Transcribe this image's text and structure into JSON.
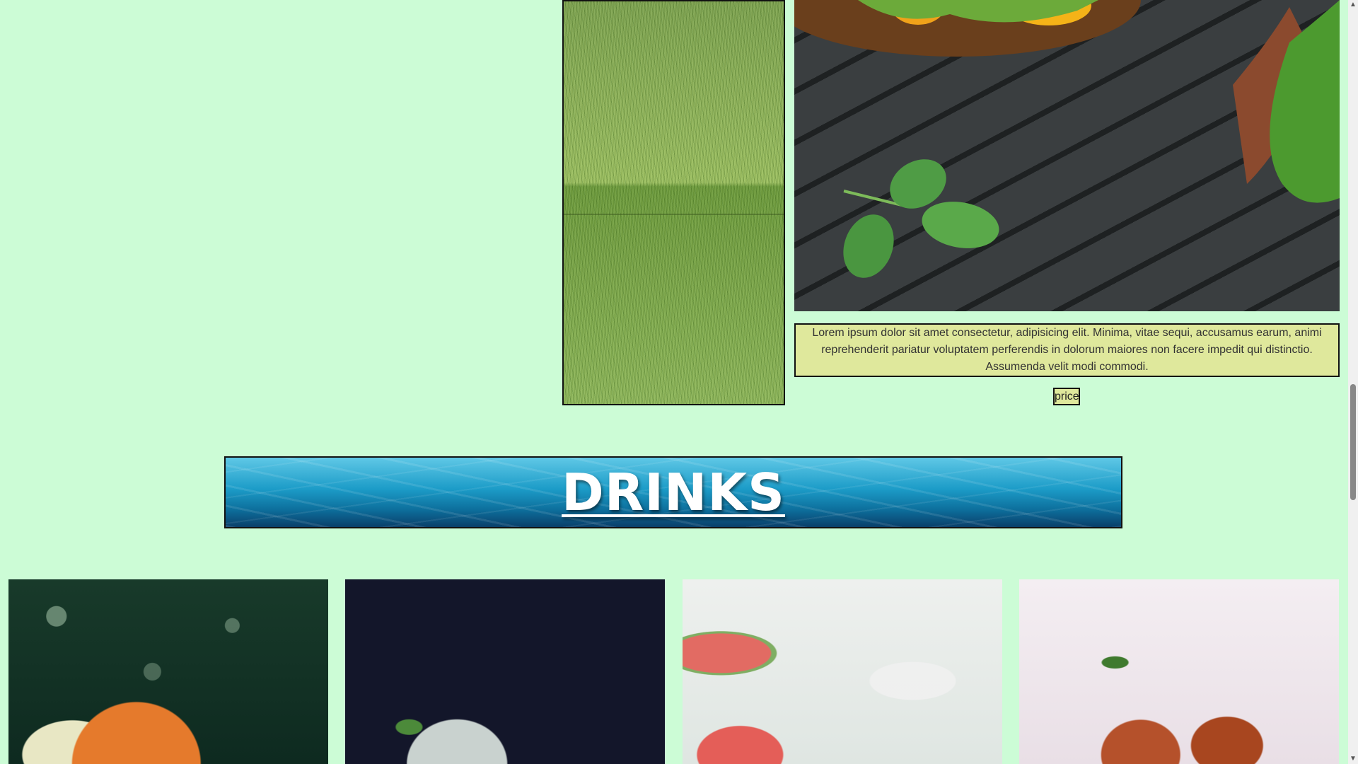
{
  "food_section": {
    "description": "Lorem ipsum dolor sit amet consectetur, adipisicing elit. Minima, vitae sequi, accusamus earum, animi reprehenderit pariatur voluptatem perferendis in dolorum maiores non facere impedit qui distinctio. Assumenda velit modi commodi.",
    "price_label": "price"
  },
  "drinks_banner": {
    "title": "DRINKS"
  },
  "drink_cards": [
    {
      "image": "cocktail-lime-image"
    },
    {
      "image": "mojito-image"
    },
    {
      "image": "watermelon-drink-image"
    },
    {
      "image": "iced-tea-image"
    }
  ],
  "colors": {
    "page_background": "#ccfcd6",
    "description_background": "#dfe89c",
    "banner_blue": "#1c9cc8"
  },
  "scrollbar": {
    "up_icon": "▲",
    "down_icon": "▼"
  }
}
